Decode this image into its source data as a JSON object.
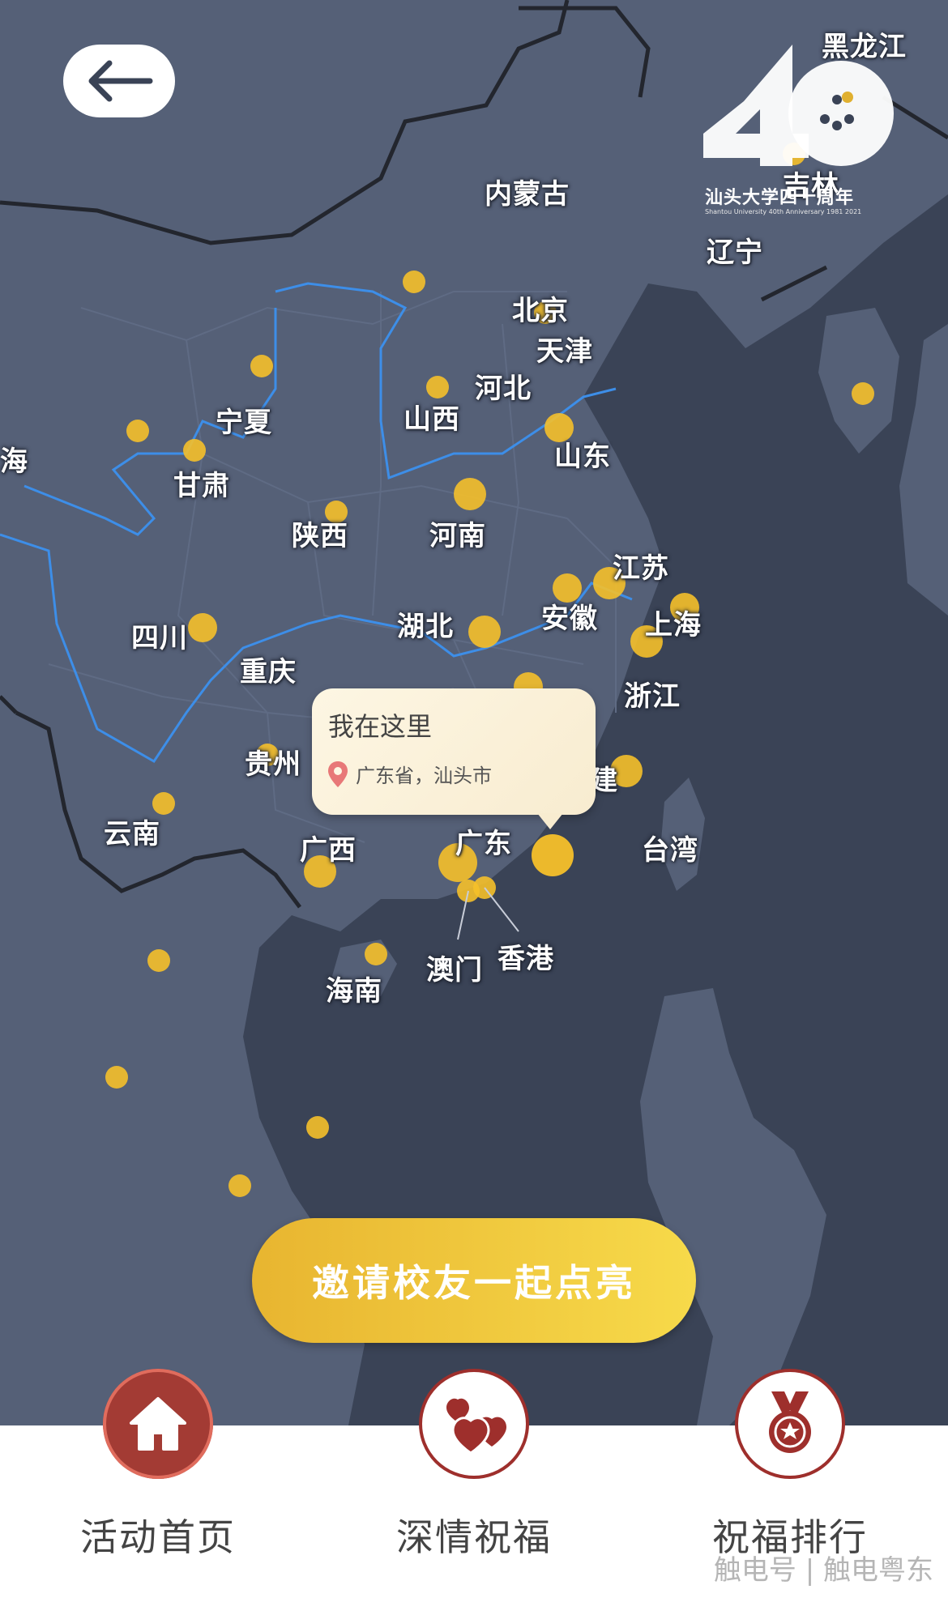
{
  "map": {
    "labels": [
      "黑龙江",
      "吉林",
      "辽宁",
      "内蒙古",
      "北京",
      "天津",
      "河北",
      "山西",
      "山东",
      "宁夏",
      "甘肃",
      "海",
      "陕西",
      "河南",
      "江苏",
      "安徽",
      "上海",
      "四川",
      "湖北",
      "重庆",
      "浙江",
      "贵州",
      "建",
      "云南",
      "广西",
      "广东",
      "台湾",
      "澳门",
      "香港",
      "海南"
    ]
  },
  "logo": {
    "number": "40",
    "title": "汕头大学四十周年",
    "subtitle": "Shantou University 40th Anniversary 1981 2021"
  },
  "popup": {
    "title": "我在这里",
    "location": "广东省，汕头市"
  },
  "invite_button": "邀请校友一起点亮",
  "tabs": [
    {
      "label": "活动首页",
      "icon": "home-icon"
    },
    {
      "label": "深情祝福",
      "icon": "hearts-icon"
    },
    {
      "label": "祝福排行",
      "icon": "medal-icon"
    }
  ],
  "watermark": "触电号 | 触电粤东",
  "colors": {
    "land": "#556077",
    "sea": "#3a4356",
    "dot": "#f5c02a",
    "accent": "#a33b34",
    "button": "#f0c53a"
  }
}
